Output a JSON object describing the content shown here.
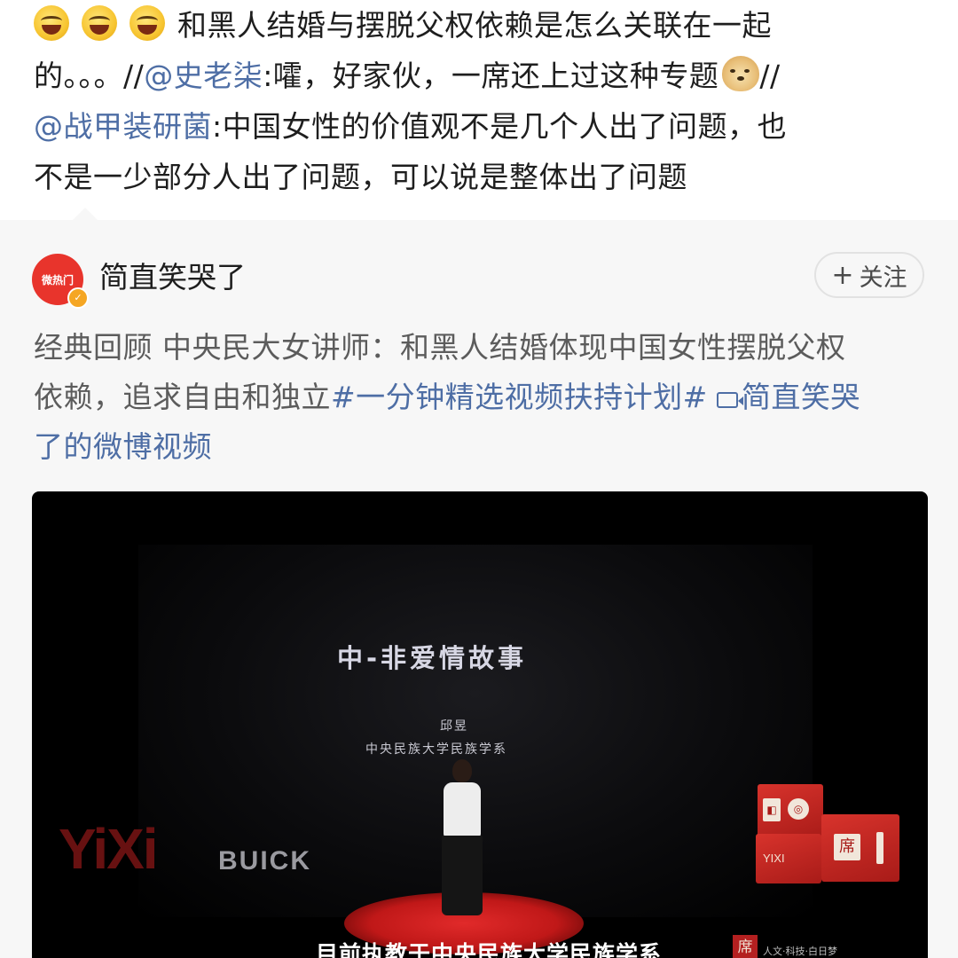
{
  "comment": {
    "line1_text": "和黑人结婚与摆脱父权依赖是怎么关联在一起",
    "line2_text": "的。。。//",
    "line2_mention": "@史老柒",
    "line2_after": ":嚯，好家伙，一席还上过这种专题",
    "line2_end": "//",
    "line3_mention": "@战甲装研菌",
    "line3_after": ":中国女性的价值观不是几个人出了问题，也",
    "line4_text": "不是一少部分人出了问题，可以说是整体出了问题",
    "emoji_names": [
      "grin-sweat-emoji",
      "grin-sweat-emoji",
      "grin-sweat-emoji",
      "doge-emoji"
    ]
  },
  "repost": {
    "avatar_text": "微热门",
    "author": "简直笑哭了",
    "follow_plus": "+",
    "follow_label": "关注",
    "line1_text": "经典回顾 中央民大女讲师：和黑人结婚体现中国女性摆脱父权",
    "line2_text": "依赖，追求自由和独立",
    "line2_hashtag": "#一分钟精选视频扶持计划#",
    "line2_link": "简直笑哭",
    "line3_link": "了的微博视频"
  },
  "video": {
    "title": "中-非爱情故事",
    "speaker_name": "邱昱",
    "speaker_org": "中央民族大学民族学系",
    "logo": "YiXi",
    "sponsor": "BUICK",
    "crate_label": "YIXI",
    "crate_seal": "席",
    "subtitle": "目前执教于中央民族大学民族学系",
    "corner_seal": "席",
    "corner_text": "人文·科技·白日梦"
  },
  "colors": {
    "link": "#4e6ea5",
    "text": "#1e1e1e",
    "muted": "#5c5c5c",
    "avatar": "#e8342c",
    "card_bg": "#f7f7f7"
  }
}
